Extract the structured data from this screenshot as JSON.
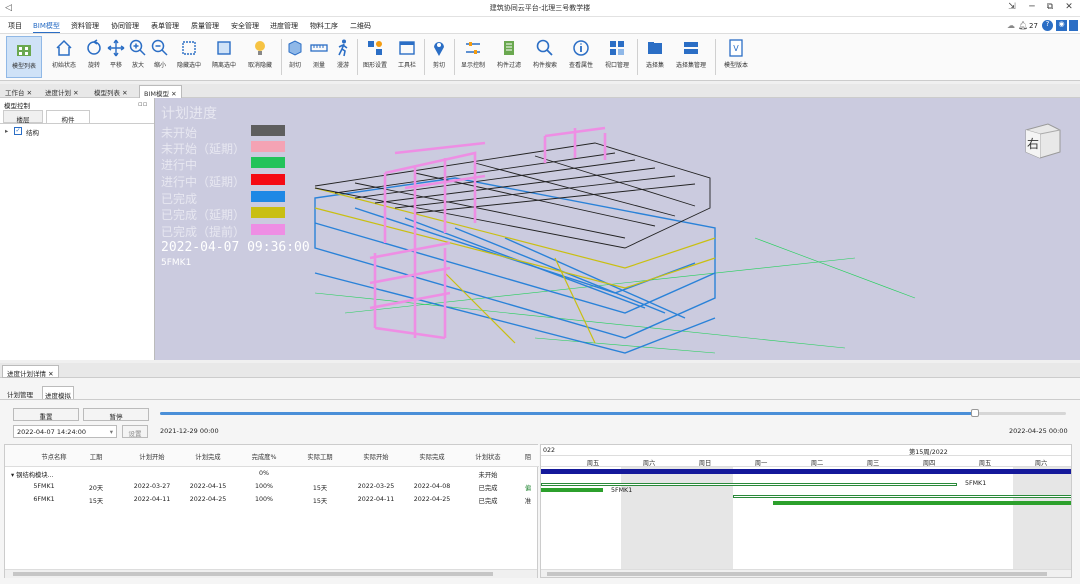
{
  "window": {
    "title": "建筑协同云平台-北理三号教学楼"
  },
  "menu": {
    "items": [
      "项目",
      "BIM模型",
      "资料管理",
      "协同管理",
      "表单管理",
      "质量管理",
      "安全管理",
      "进度管理",
      "物料工序",
      "二维码"
    ],
    "notify_count": "27"
  },
  "toolbar": {
    "items": [
      "模型列表",
      "初始状态",
      "旋转",
      "平移",
      "放大",
      "缩小",
      "隐藏选中",
      "隔离选中",
      "取消隐藏",
      "剖切",
      "测量",
      "漫游",
      "图形设置",
      "工具栏",
      "剪切",
      "显示控制",
      "构件过滤",
      "构件搜索",
      "查看属性",
      "视口管理",
      "选择集",
      "选择集管理",
      "模型版本"
    ]
  },
  "doc_tabs": [
    "工作台",
    "进度计划",
    "模型列表",
    "BIM模型"
  ],
  "left_panel": {
    "title": "模型控制",
    "tabs": [
      "楼层",
      "构件"
    ],
    "tree_item": "结构"
  },
  "viewport": {
    "legend_title": "计划进度",
    "legend": [
      {
        "label": "未开始",
        "color": "#5e5e5e"
      },
      {
        "label": "未开始（延期）",
        "color": "#f4a3b4"
      },
      {
        "label": "进行中",
        "color": "#23c35a"
      },
      {
        "label": "进行中（延期）",
        "color": "#f50a14"
      },
      {
        "label": "已完成",
        "color": "#1e88e5"
      },
      {
        "label": "已完成（延期）",
        "color": "#c9bf12"
      },
      {
        "label": "已完成（提前）",
        "color": "#ee8ee4"
      }
    ],
    "datetime": "2022-04-07  09:36:00",
    "node": "5FMK1",
    "cube_face": "右"
  },
  "bottom": {
    "panel_tab": "进度计划详情",
    "subtabs": [
      "计划管理",
      "进度模拟"
    ],
    "reset_label": "重置",
    "pause_label": "暂停",
    "set_label": "设置",
    "date_value": "2022-04-07 14:24:00",
    "slider_start": "2021-12-29 00:00",
    "slider_end": "2022-04-25 00:00",
    "slider_progress": 0.9,
    "columns": [
      "节点名称",
      "工期",
      "计划开始",
      "计划完成",
      "完成度%",
      "实际工期",
      "实际开始",
      "实际完成",
      "计划状态",
      "阻"
    ],
    "rows": [
      [
        "▾  钢结构模块...",
        "",
        "",
        "",
        "0%",
        "",
        "",
        "",
        "未开始",
        ""
      ],
      [
        "5FMK1",
        "20天",
        "2022-03-27",
        "2022-04-15",
        "100%",
        "15天",
        "2022-03-25",
        "2022-04-08",
        "已完成",
        "偏"
      ],
      [
        "6FMK1",
        "15天",
        "2022-04-11",
        "2022-04-25",
        "100%",
        "15天",
        "2022-04-11",
        "2022-04-25",
        "已完成",
        "准"
      ]
    ],
    "gantt": {
      "left_week": "022",
      "right_week": "第15周/2022",
      "days": [
        "周五",
        "周六",
        "周日",
        "周一",
        "周二",
        "周三",
        "周四",
        "周五",
        "周六"
      ],
      "bar_labels": [
        "5FMK1",
        "5FMK1"
      ]
    }
  }
}
